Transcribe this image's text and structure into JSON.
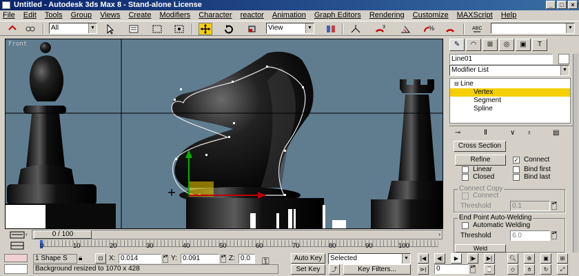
{
  "window": {
    "title": "Untitled - Autodesk 3ds Max 8 - Stand-alone License"
  },
  "menu": [
    "File",
    "Edit",
    "Tools",
    "Group",
    "Views",
    "Create",
    "Modifiers",
    "Character",
    "reactor",
    "Animation",
    "Graph Editors",
    "Rendering",
    "Customize",
    "MAXScript",
    "Help"
  ],
  "toolbar": {
    "selection_filter": "All",
    "ref_coord": "View"
  },
  "viewport": {
    "label": "Front",
    "accent_color": "#f5d000"
  },
  "command_panel": {
    "object_name": "Line01",
    "modifier_list_label": "Modifier List",
    "stack": {
      "root": "Line",
      "items": [
        "Vertex",
        "Segment",
        "Spline"
      ],
      "selected": "Vertex"
    },
    "cross_section_button": "Cross Section",
    "refine_button": "Refine",
    "connect_label": "Connect",
    "linear_label": "Linear",
    "bind_first_label": "Bind first",
    "closed_label": "Closed",
    "bind_last_label": "Bind last",
    "connect_copy": {
      "title": "Connect Copy",
      "connect_label": "Connect",
      "threshold_label": "Threshold",
      "threshold_value": "0.1"
    },
    "weld": {
      "title": "End Point Auto-Welding",
      "auto_label": "Automatic Welding",
      "threshold_label": "Threshold",
      "threshold_value": "6.0",
      "weld_label": "Weld"
    }
  },
  "timeline": {
    "frame_display": "0 / 100",
    "ticks": [
      "0",
      "10",
      "20",
      "30",
      "40",
      "50",
      "60",
      "70",
      "80",
      "90",
      "100"
    ]
  },
  "status": {
    "selection": "1 Shape S",
    "message": "Background resized to 1070 x 428",
    "x_label": "X:",
    "x_value": "0.014",
    "y_label": "Y:",
    "y_value": "0.091",
    "z_label": "Z:",
    "z_value": "0.0",
    "auto_key": "Auto Key",
    "set_key": "Set Key",
    "key_mode": "Selected",
    "key_filters": "Key Filters...",
    "frame": "0"
  }
}
